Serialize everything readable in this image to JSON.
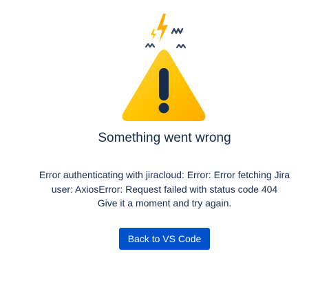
{
  "error": {
    "title": "Something went wrong",
    "message_lines": [
      "Error authenticating with jiracloud: Error: Error fetching Jira",
      "user: AxiosError: Request failed with status code 404",
      "Give it a moment and try again."
    ],
    "button_label": "Back to VS Code"
  },
  "colors": {
    "accent": "#0052cc",
    "warning_yellow": "#ffc400",
    "warning_dark": "#ffab00",
    "text": "#172b4d"
  },
  "icons": {
    "illustration": "warning-triangle-icon"
  }
}
